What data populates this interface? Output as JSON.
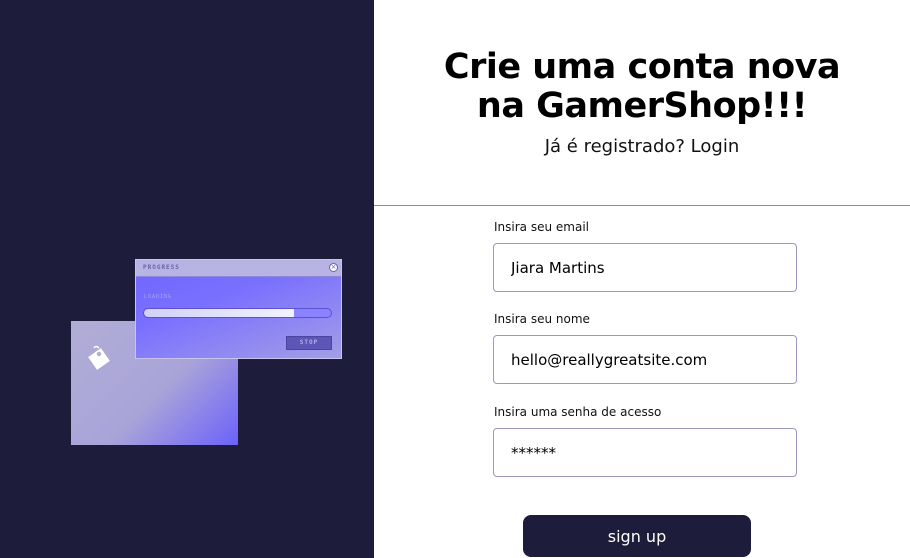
{
  "colors": {
    "panel_dark": "#1d1c3b",
    "accent": "#6f64ff",
    "button_bg": "#1d1c3b",
    "button_text": "#ffffff"
  },
  "illustration": {
    "window_title": "PROGRESS",
    "close_icon": "close-icon",
    "status_text": "LOADING",
    "progress": 0.8,
    "stop_label": "STOP",
    "tag_icon": "tag-icon"
  },
  "header": {
    "title_line1": "Crie uma conta nova",
    "title_line2": "na GamerShop!!!",
    "login_prompt": "Já é registrado? Login"
  },
  "form": {
    "email_label": "Insira seu email",
    "email_value": "Jiara Martins",
    "name_label": "Insira seu nome",
    "name_value": "hello@reallygreatsite.com",
    "password_label": "Insira uma senha de acesso",
    "password_value": "******",
    "submit_label": "sign up"
  }
}
